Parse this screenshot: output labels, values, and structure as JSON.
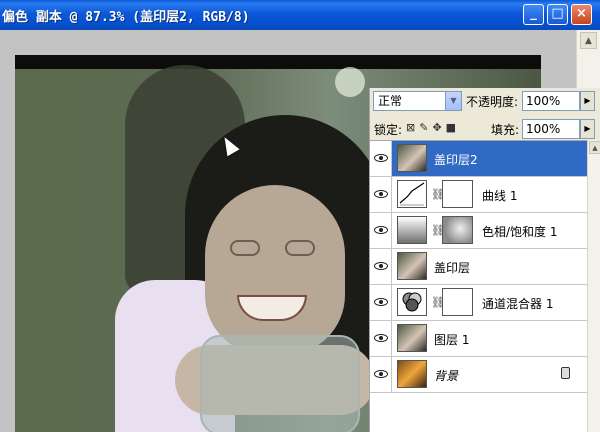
{
  "window": {
    "title": "偏色 副本 @ 87.3% (盖印层2, RGB/8)",
    "minimize_icon": "minimize-icon",
    "maximize_icon": "maximize-icon",
    "close_icon": "close-icon",
    "title_bar_color": "#0b58d8"
  },
  "canvas": {
    "cursor_icon": "arrow-cursor-icon"
  },
  "layers_panel": {
    "blend_mode": "正常",
    "opacity_label": "不透明度:",
    "opacity_value": "100%",
    "lock_label": "锁定:",
    "lock_icons": [
      "lock-transparent-icon",
      "lock-paint-icon",
      "lock-move-icon",
      "lock-all-icon"
    ],
    "fill_label": "填充:",
    "fill_value": "100%",
    "selected_color": "#316ac5",
    "layers": [
      {
        "name": "盖印层2",
        "selected": true,
        "thumbnail": "photo",
        "visible": true
      },
      {
        "name": "曲线 1",
        "selected": false,
        "thumbnail": "curves-adjustment",
        "mask": "white",
        "visible": true
      },
      {
        "name": "色相/饱和度 1",
        "selected": false,
        "thumbnail": "hue-saturation-adjustment",
        "mask": "grey",
        "visible": true
      },
      {
        "name": "盖印层",
        "selected": false,
        "thumbnail": "photo",
        "visible": true
      },
      {
        "name": "通道混合器 1",
        "selected": false,
        "thumbnail": "channel-mixer-adjustment",
        "mask": "white",
        "visible": true
      },
      {
        "name": "图层 1",
        "selected": false,
        "thumbnail": "photo",
        "visible": true
      },
      {
        "name": "背景",
        "selected": false,
        "thumbnail": "background-photo",
        "locked": true,
        "visible": true
      }
    ]
  }
}
